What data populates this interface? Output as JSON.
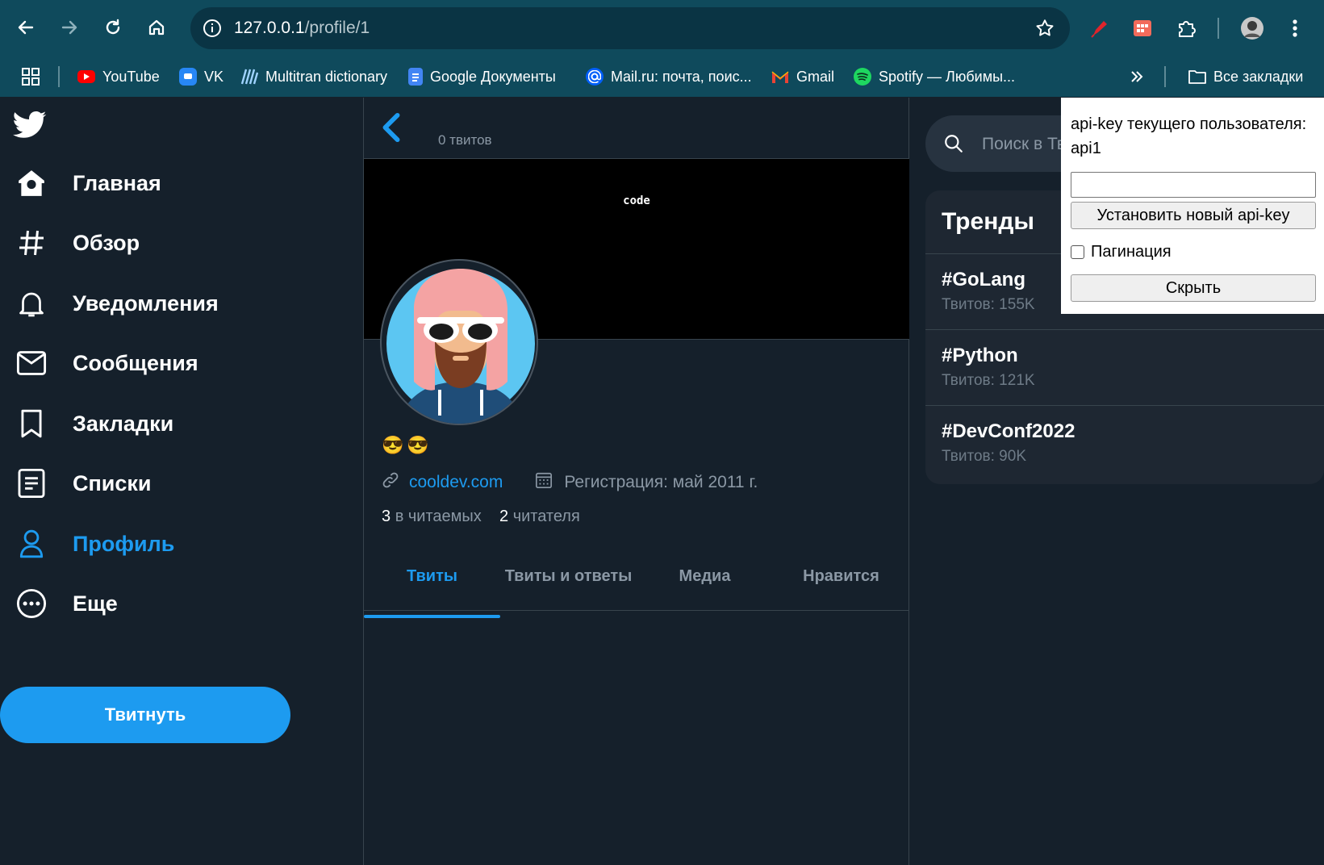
{
  "browser": {
    "url_host": "127.0.0.1",
    "url_path": "/profile/1",
    "bookmarks": [
      {
        "label": "YouTube",
        "icon": "youtube-icon"
      },
      {
        "label": "VK",
        "icon": "vk-icon"
      },
      {
        "label": "Multitran dictionary",
        "icon": "multitran-icon"
      },
      {
        "label": "Google Документы",
        "icon": "google-docs-icon"
      },
      {
        "label": "Mail.ru: почта, поис...",
        "icon": "mailru-icon"
      },
      {
        "label": "Gmail",
        "icon": "gmail-icon"
      },
      {
        "label": "Spotify — Любимы...",
        "icon": "spotify-icon"
      }
    ],
    "all_bookmarks": "Все закладки"
  },
  "sidebar": {
    "nav": [
      {
        "label": "Главная",
        "icon": "home-icon"
      },
      {
        "label": "Обзор",
        "icon": "hashtag-icon"
      },
      {
        "label": "Уведомления",
        "icon": "bell-icon"
      },
      {
        "label": "Сообщения",
        "icon": "mail-icon"
      },
      {
        "label": "Закладки",
        "icon": "bookmark-icon"
      },
      {
        "label": "Списки",
        "icon": "list-icon"
      },
      {
        "label": "Профиль",
        "icon": "profile-icon",
        "active": true
      },
      {
        "label": "Еще",
        "icon": "more-icon"
      }
    ],
    "tweet_button": "Твитнуть"
  },
  "profile": {
    "tweet_count": "0 твитов",
    "banner_text": "code",
    "name_emoji": "😎😎",
    "website": "cooldev.com",
    "registration": "Регистрация: май 2011 г.",
    "following_count": "3",
    "following_label": "в читаемых",
    "followers_count": "2",
    "followers_label": "читателя",
    "tabs": [
      "Твиты",
      "Твиты и ответы",
      "Медиа",
      "Нравится"
    ],
    "active_tab": "Твиты"
  },
  "right": {
    "search_placeholder": "Поиск в Твиттере",
    "trends_title": "Тренды",
    "trends": [
      {
        "tag": "#GoLang",
        "count": "Твитов: 155K"
      },
      {
        "tag": "#Python",
        "count": "Твитов: 121K"
      },
      {
        "tag": "#DevConf2022",
        "count": "Твитов: 90K"
      }
    ]
  },
  "popup": {
    "label": "api-key текущего пользователя: api1",
    "input_value": "",
    "set_button": "Установить новый api-key",
    "checkbox_label": "Пагинация",
    "checkbox_checked": false,
    "hide_button": "Скрыть"
  },
  "colors": {
    "accent": "#1d9bf0",
    "background": "#15202b",
    "chrome": "#0f4a5c"
  }
}
